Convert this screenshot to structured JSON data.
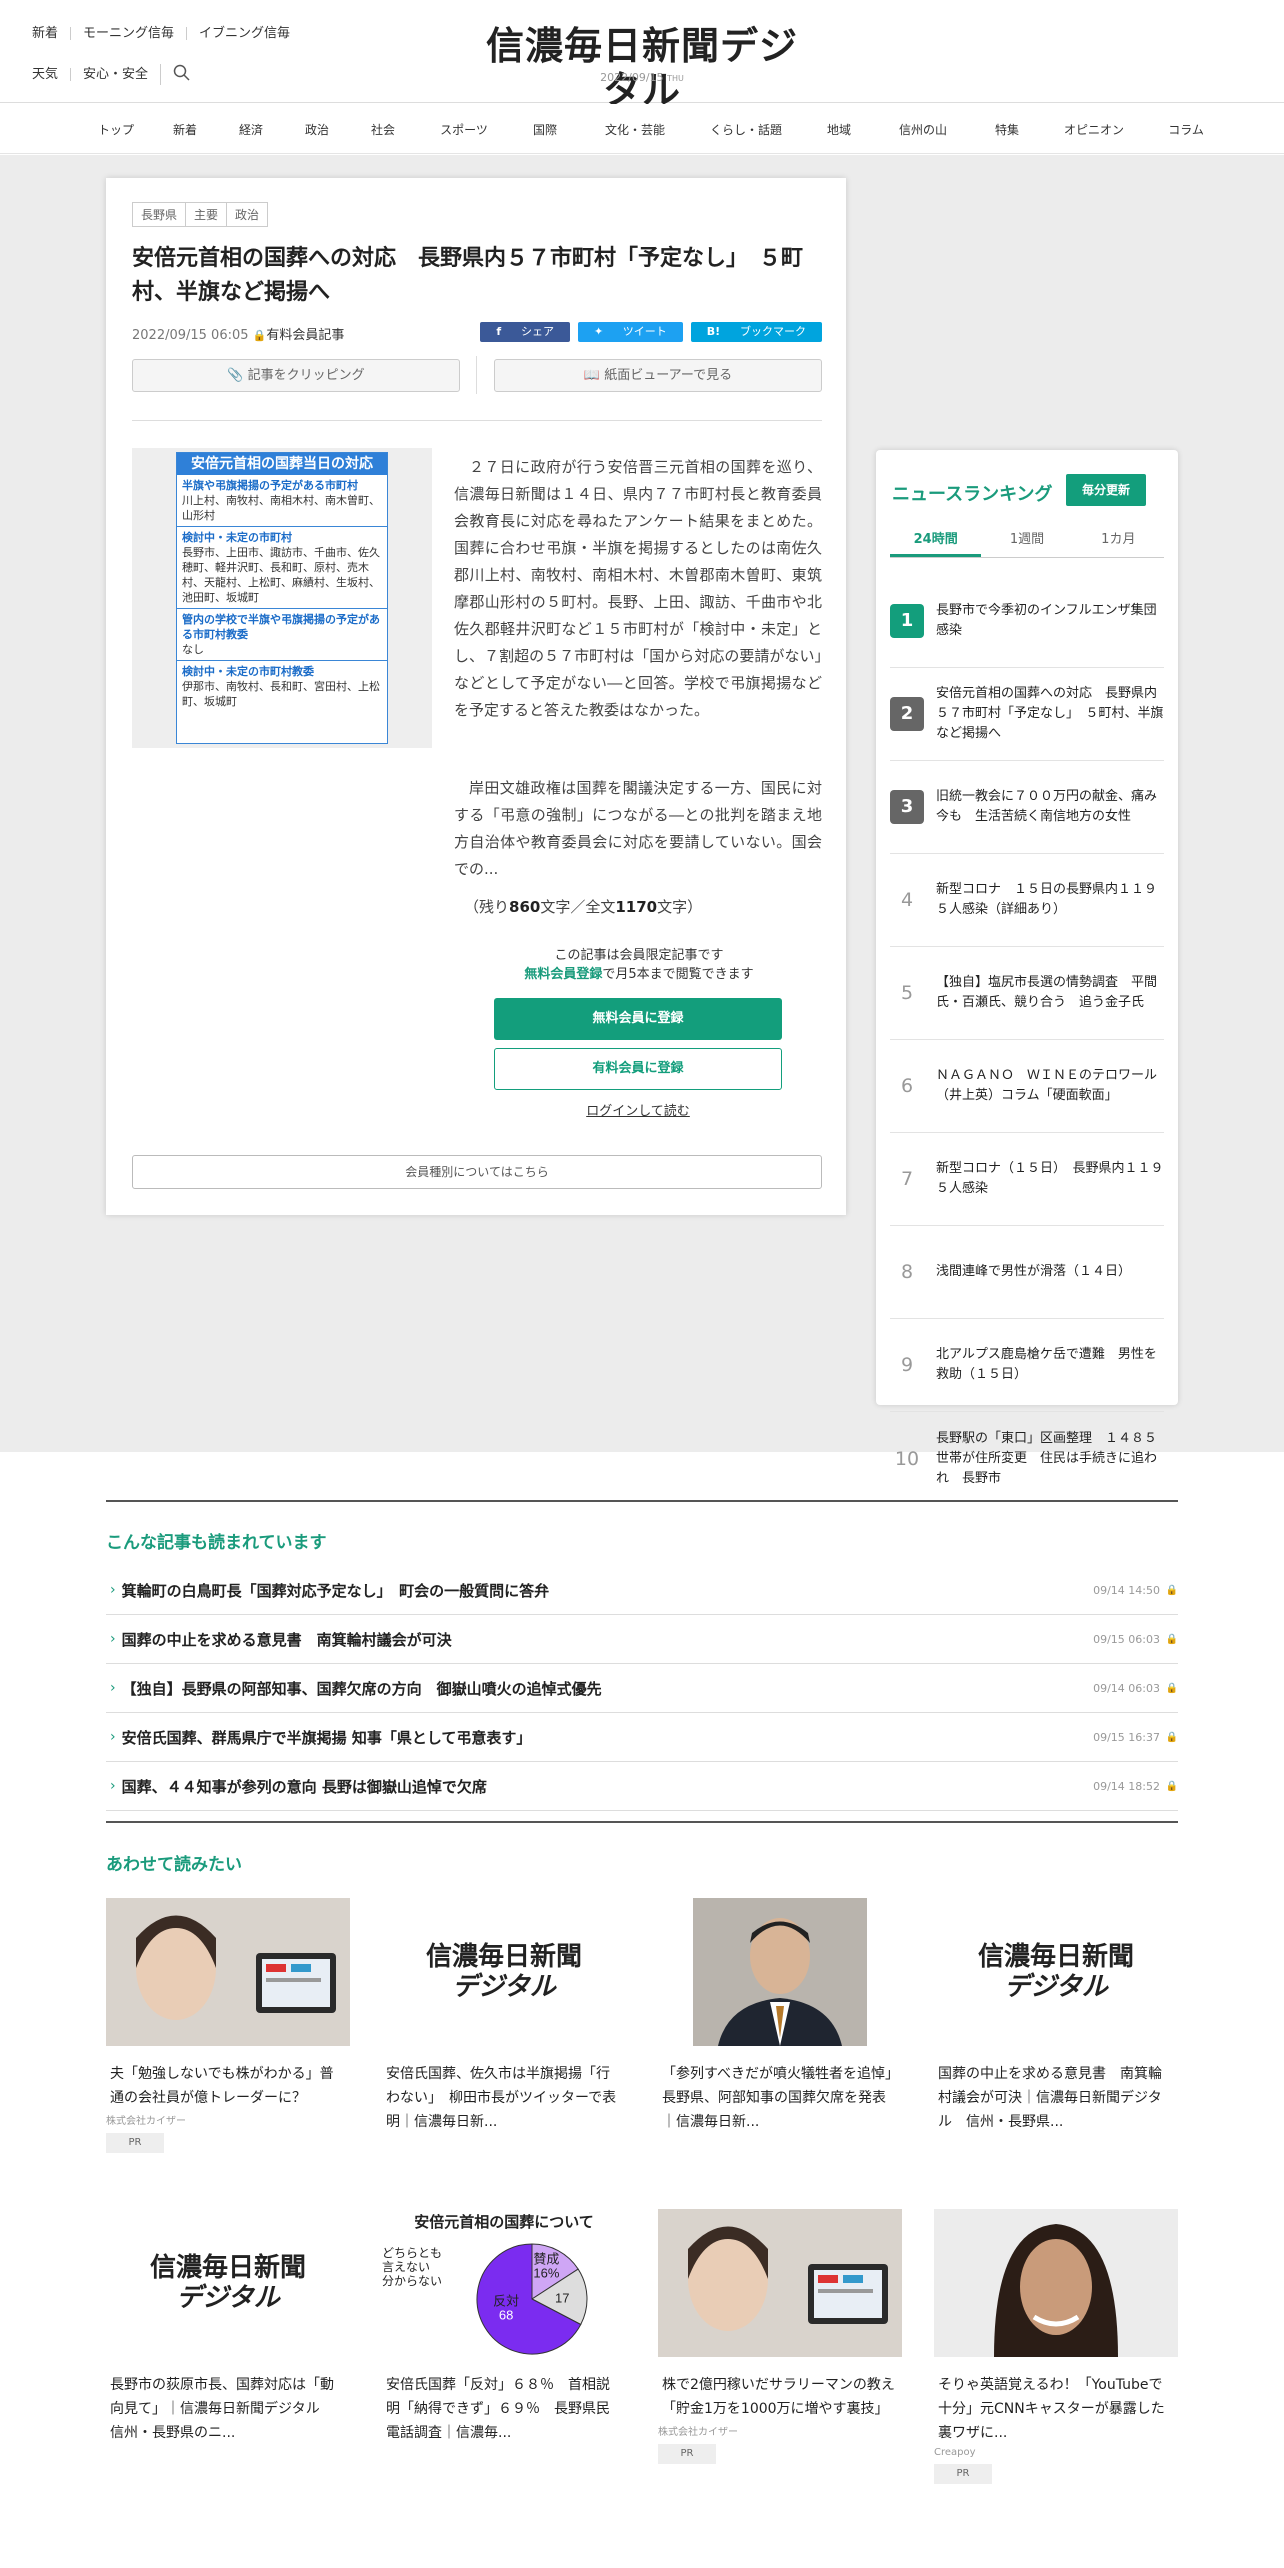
{
  "header": {
    "links_row1": [
      "新着",
      "モーニング信毎",
      "イブニング信毎"
    ],
    "links_row2": [
      "天気",
      "安心・安全"
    ],
    "logo": "信濃毎日新聞デジタル",
    "date": "2022/09/15",
    "weekday": "THU"
  },
  "nav": [
    "トップ",
    "新着",
    "経済",
    "政治",
    "社会",
    "スポーツ",
    "国際",
    "文化・芸能",
    "くらし・話題",
    "地域",
    "信州の山",
    "特集",
    "オピニオン",
    "コラム"
  ],
  "article": {
    "tags": [
      "長野県",
      "主要",
      "政治"
    ],
    "title": "安倍元首相の国葬への対応　長野県内５７市町村「予定なし」　５町村、半旗など掲揚へ",
    "published": "2022/09/15 06:05",
    "paid_label": "有料会員記事",
    "share": [
      "シェア",
      "ツイート",
      "ブックマーク"
    ],
    "share_colors": {
      "facebook": "#3b5998",
      "twitter": "#1da1f2",
      "hatena": "#00a4de"
    },
    "clip_label": "記事をクリッピング",
    "viewer_label": "紙面ビューアーで見る",
    "figure": {
      "title": "安倍元首相の国葬当日の対応",
      "sections": [
        {
          "q": "半旗や弔旗掲揚の予定がある市町村",
          "a": "川上村、南牧村、南相木村、南木曽町、山形村"
        },
        {
          "q": "検討中・未定の市町村",
          "a": "長野市、上田市、諏訪市、千曲市、佐久穂町、軽井沢町、長和町、原村、売木村、天龍村、上松町、麻績村、生坂村、池田町、坂城町"
        },
        {
          "q": "管内の学校で半旗や弔旗掲揚の予定がある市町村教委",
          "a": "なし"
        },
        {
          "q": "検討中・未定の市町村教委",
          "a": "伊那市、南牧村、長和町、宮田村、上松町、坂城町"
        }
      ]
    },
    "body_p1": "２７日に政府が行う安倍晋三元首相の国葬を巡り、信濃毎日新聞は１４日、県内７７市町村長と教育委員会教育長に対応を尋ねたアンケート結果をまとめた。国葬に合わせ弔旗・半旗を掲揚するとしたのは南佐久郡川上村、南牧村、南相木村、木曽郡南木曽町、東筑摩郡山形村の５町村。長野、上田、諏訪、千曲市や北佐久郡軽井沢町など１５市町村が「検討中・未定」とし、７割超の５７市町村は「国から対応の要請がない」などとして予定がない―と回答。学校で弔旗掲揚などを予定すると答えた教委はなかった。",
    "body_p2": "岸田文雄政権は国葬を閣議決定する一方、国民に対する「弔意の強制」につながる―との批判を踏まえ地方自治体や教育委員会に対応を要請していない。国会での...",
    "rest_prefix": "（残り",
    "rest_chars": "860",
    "rest_mid": "文字／全文",
    "total_chars": "1170",
    "rest_suffix": "文字）",
    "lock_line1": "この記事は会員限定記事です",
    "lock_line2_link": "無料会員登録",
    "lock_line2_rest": "で月5本まで閲覧できます",
    "btn_free": "無料会員に登録",
    "btn_paid": "有料会員に登録",
    "login": "ログインして読む",
    "member_types": "会員種別についてはこちら"
  },
  "ranking": {
    "title": "ニュースランキング",
    "update": "毎分更新",
    "tabs": [
      "24時間",
      "1週間",
      "1カ月"
    ],
    "items": [
      {
        "n": "1",
        "t": "長野市で今季初のインフルエンザ集団感染"
      },
      {
        "n": "2",
        "t": "安倍元首相の国葬への対応　長野県内５７市町村「予定なし」　５町村、半旗など掲揚へ"
      },
      {
        "n": "3",
        "t": "旧統一教会に７００万円の献金、痛み今も　生活苦続く南信地方の女性"
      },
      {
        "n": "4",
        "t": "新型コロナ　１５日の長野県内１１９５人感染（詳細あり）"
      },
      {
        "n": "5",
        "t": "【独自】塩尻市長選の情勢調査　平間氏・百瀬氏、競り合う　追う金子氏"
      },
      {
        "n": "6",
        "t": "ＮＡＧＡＮＯ　ＷＩＮＥのテロワール（井上英）コラム「硬面軟面」"
      },
      {
        "n": "7",
        "t": "新型コロナ（１５日）　長野県内１１９５人感染"
      },
      {
        "n": "8",
        "t": "浅間連峰で男性が滑落（１４日）"
      },
      {
        "n": "9",
        "t": "北アルプス鹿島槍ケ岳で遭難　男性を救助（１５日）"
      },
      {
        "n": "10",
        "t": "長野駅の「東口」区画整理　１４８５世帯が住所変更　住民は手続きに追われ　長野市"
      }
    ]
  },
  "related": {
    "title": "こんな記事も読まれています",
    "items": [
      {
        "t": "箕輪町の白鳥町長「国葬対応予定なし」　町会の一般質問に答弁",
        "d": "09/14 14:50"
      },
      {
        "t": "国葬の中止を求める意見書　南箕輪村議会が可決",
        "d": "09/15 06:03"
      },
      {
        "t": "【独自】長野県の阿部知事、国葬欠席の方向　御嶽山噴火の追悼式優先",
        "d": "09/14 06:03"
      },
      {
        "t": "安倍氏国葬、群馬県庁で半旗掲揚 知事「県として弔意表す」",
        "d": "09/15 16:37"
      },
      {
        "t": "国葬、４４知事が参列の意向 長野は御嶽山追悼で欠席",
        "d": "09/14 18:52"
      }
    ]
  },
  "recommend": {
    "title": "あわせて読みたい",
    "row1": [
      {
        "t": "夫「勉強しないでも株がわかる」普通の会社員が億トレーダーに？",
        "sp": "株式会社カイザー",
        "pr": "PR"
      },
      {
        "t": "安倍氏国葬、佐久市は半旗掲揚「行わない」　柳田市長がツイッターで表明｜信濃毎日新...",
        "logo1": "信濃毎日新聞",
        "logo2": "デジタル"
      },
      {
        "t": "「参列すべきだが噴火犠牲者を追悼」　長野県、阿部知事の国葬欠席を発表｜信濃毎日新..."
      },
      {
        "t": "国葬の中止を求める意見書　南箕輪村議会が可決｜信濃毎日新聞デジタル　信州・長野県...",
        "logo1": "信濃毎日新聞",
        "logo2": "デジタル"
      }
    ],
    "row2": [
      {
        "t": "長野市の荻原市長、国葬対応は「動向見て」｜信濃毎日新聞デジタル　信州・長野県のニ...",
        "logo1": "信濃毎日新聞",
        "logo2": "デジタル"
      },
      {
        "t": "安倍氏国葬「反対」６８％　首相説明「納得できず」６９％　長野県民電話調査｜信濃毎...",
        "chart_title": "安倍元首相の国葬について",
        "chart_labels": {
          "neutral": "どちらとも言えない分からない",
          "agree": "賛成",
          "oppose": "反対"
        }
      },
      {
        "t": "株で2億円稼いだサラリーマンの教え「貯金1万を1000万に増やす裏技」",
        "sp": "株式会社カイザー",
        "pr": "PR"
      },
      {
        "t": "そりゃ英語覚えるわ！「YouTubeで十分」元CNNキャスターが暴露した裏ワザに...",
        "sp": "Creapoy",
        "pr": "PR"
      }
    ]
  },
  "chart_data": {
    "type": "pie",
    "title": "安倍元首相の国葬について",
    "categories": [
      "反対",
      "どちらとも言えない分からない",
      "賛成"
    ],
    "values": [
      68,
      17,
      16
    ],
    "colors": [
      "#7b2cf0",
      "#dddddd",
      "#cfa6f5"
    ]
  }
}
